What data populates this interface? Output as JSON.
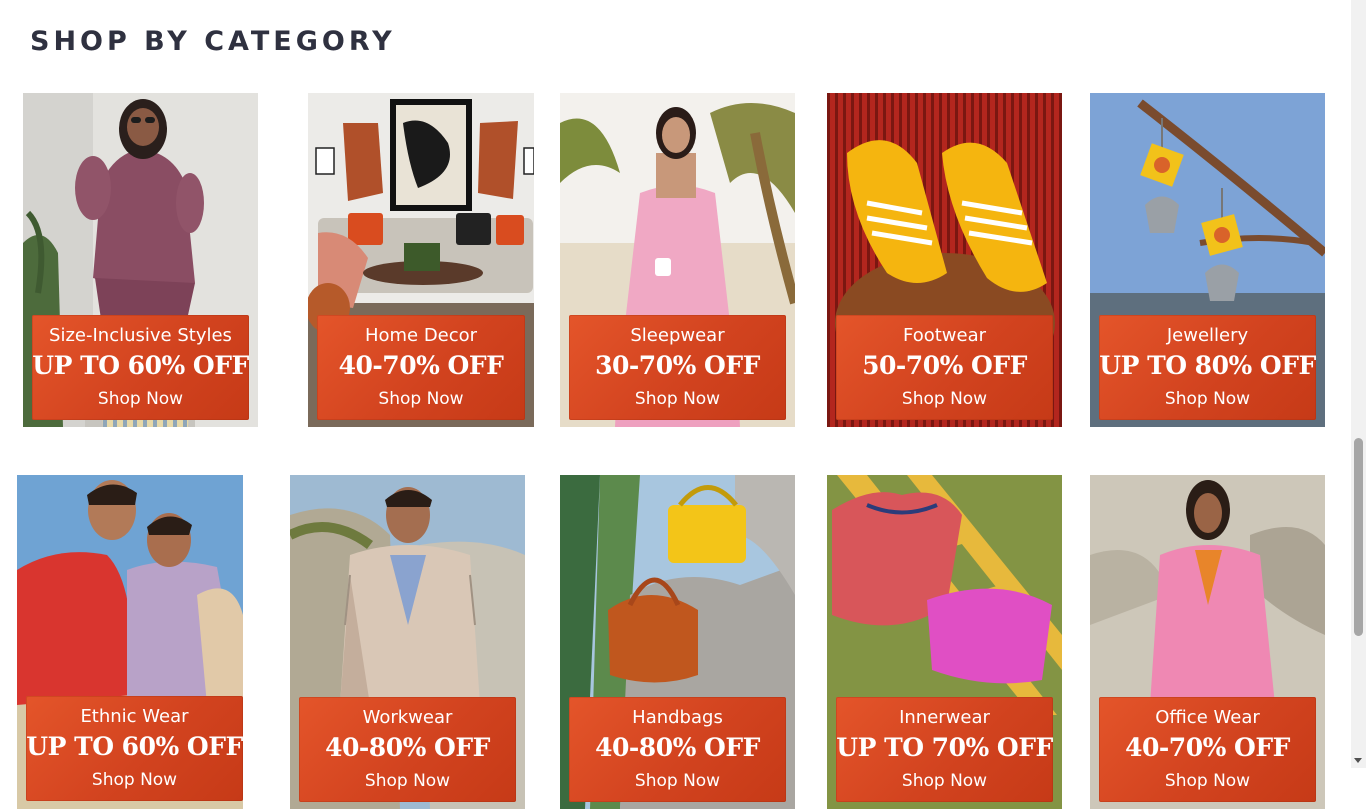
{
  "section": {
    "title": "SHOP BY CATEGORY"
  },
  "categories": [
    {
      "name": "Size-Inclusive Styles",
      "discount": "UP TO 60% OFF",
      "cta": "Shop Now",
      "image": "plus-size-woman-blouse"
    },
    {
      "name": "Home Decor",
      "discount": "40-70% OFF",
      "cta": "Shop Now",
      "image": "living-room-sofa"
    },
    {
      "name": "Sleepwear",
      "discount": "30-70% OFF",
      "cta": "Shop Now",
      "image": "woman-pink-slip-dress"
    },
    {
      "name": "Footwear",
      "discount": "50-70% OFF",
      "cta": "Shop Now",
      "image": "yellow-sneakers"
    },
    {
      "name": "Jewellery",
      "discount": "UP TO 80% OFF",
      "cta": "Shop Now",
      "image": "jhumka-earrings"
    },
    {
      "name": "Ethnic Wear",
      "discount": "UP TO 60% OFF",
      "cta": "Shop Now",
      "image": "men-kurta"
    },
    {
      "name": "Workwear",
      "discount": "40-80% OFF",
      "cta": "Shop Now",
      "image": "man-checked-blazer"
    },
    {
      "name": "Handbags",
      "discount": "40-80% OFF",
      "cta": "Shop Now",
      "image": "handbags-on-rock"
    },
    {
      "name": "Innerwear",
      "discount": "UP TO 70% OFF",
      "cta": "Shop Now",
      "image": "tank-top-shorts-ladder"
    },
    {
      "name": "Office Wear",
      "discount": "40-70% OFF",
      "cta": "Shop Now",
      "image": "woman-pink-suit"
    }
  ]
}
